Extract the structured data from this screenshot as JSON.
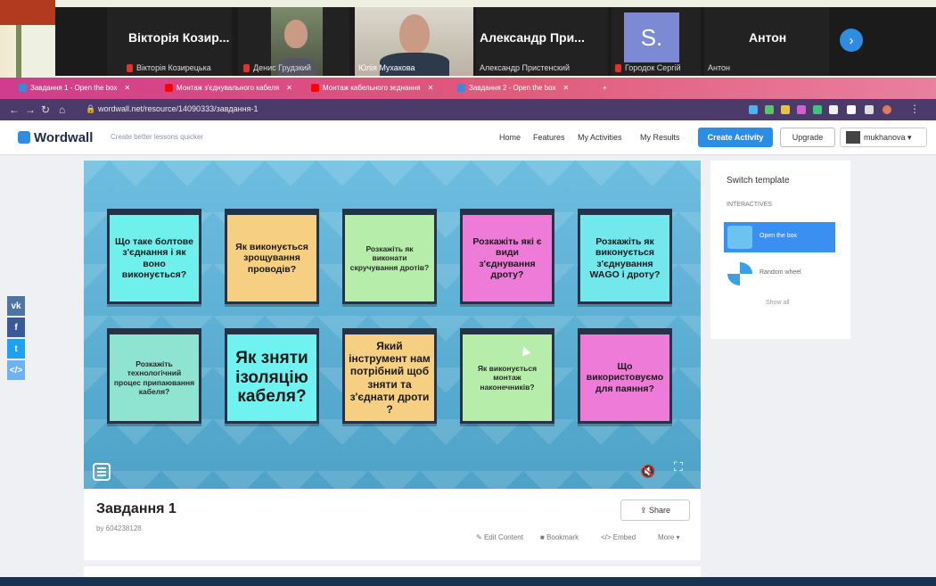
{
  "zoom": {
    "participants": [
      {
        "name": "Вікторія Козир...",
        "sub": "Вікторія Козирецька"
      },
      {
        "name": "",
        "sub": "Денис Грудзкий"
      },
      {
        "name": "",
        "sub": "Юлія Мухакова"
      },
      {
        "name": "Александр При...",
        "sub": "Александр Пристенский"
      },
      {
        "name": "S.",
        "sub": "Городок Сергій"
      },
      {
        "name": "Антон",
        "sub": "Антон"
      }
    ]
  },
  "browser": {
    "tabs": [
      "Завдання 1 - Open the box",
      "Монтаж з'єднувального кабеля",
      "Монтаж кабельного зєднання",
      "Завдання 2 - Open the box"
    ],
    "url": "wordwall.net/resource/14090333/завдання-1"
  },
  "wordwall": {
    "logo": "Wordwall",
    "tagline": "Create better lessons quicker",
    "nav": [
      "Home",
      "Features",
      "My Activities",
      "My Results"
    ],
    "create_label": "Create Activity",
    "upgrade_label": "Upgrade",
    "user_label": "mukhanova"
  },
  "boxes": [
    {
      "text": "Що таке болтове з'єднання і як воно виконується?",
      "color": "#6ff0ec"
    },
    {
      "text": "Як виконується зрощування проводів?",
      "color": "#f6cf82"
    },
    {
      "text": "Розкажіть як виконати скручування дротів?",
      "color": "#b7edaa"
    },
    {
      "text": "Розкажіть які є види з'єднування дроту?",
      "color": "#ef7bd9"
    },
    {
      "text": "Розкажіть як виконується з'єднування WAGO і дроту?",
      "color": "#72e8ec"
    },
    {
      "text": "Розкажіть технологічний процес припаювання кабеля?",
      "color": "#8ee4d1"
    },
    {
      "text": "Як зняти ізоляцію кабеля?",
      "color": "#6ff2f0"
    },
    {
      "text": "Який інструмент нам потрібний щоб зняти та з'єднати дроти ?",
      "color": "#f6cf82"
    },
    {
      "text": "Як виконується монтаж наконечників?",
      "color": "#b7edaa"
    },
    {
      "text": "Що використовуємо для паяння?",
      "color": "#ef7bd9"
    }
  ],
  "activity": {
    "title": "Завдання 1",
    "author": "by 604238128",
    "share": "Share",
    "actions": [
      "Edit Content",
      "Bookmark",
      "Embed",
      "More"
    ]
  },
  "sidebar": {
    "heading": "Switch template",
    "section": "INTERACTIVES",
    "templates": [
      "Open the box",
      "Random wheel"
    ],
    "show_all": "Show all"
  },
  "colors": {
    "tabbar": "#d13c8c",
    "accent": "#2c8de6"
  }
}
